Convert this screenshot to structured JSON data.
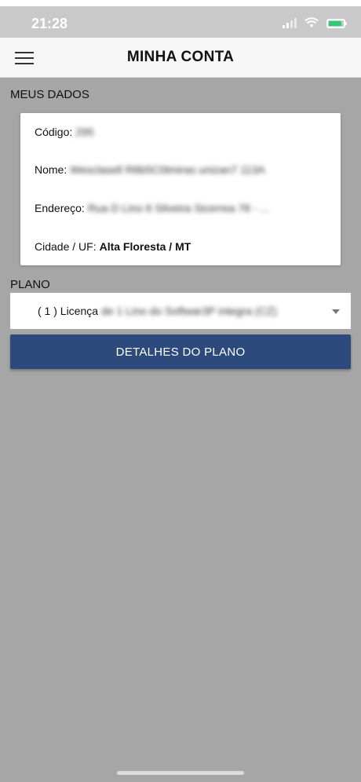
{
  "status_bar": {
    "time": "21:28"
  },
  "header": {
    "title": "MINHA CONTA"
  },
  "meus_dados": {
    "section_label": "MEUS DADOS",
    "codigo_label": "Código:",
    "codigo_value": "295",
    "nome_label": "Nome:",
    "nome_value": "Wesclasell R6b5C0tmiras unizan7 113A",
    "endereco_label": "Endereço:",
    "endereco_value": "Rua D Lino 6 Silveira Sicerrea 78 - ...",
    "cidade_label": "Cidade / UF:",
    "cidade_value": "Alta Floresta / MT"
  },
  "plano": {
    "section_label": "PLANO",
    "selected_prefix": "( 1 ) Licença",
    "selected_rest": "de 1 Lino do Softwar3P integra (CZ)",
    "details_button": "DETALHES DO PLANO"
  }
}
